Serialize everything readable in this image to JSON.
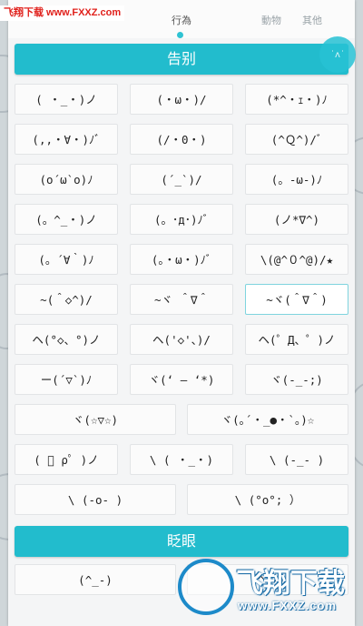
{
  "watermark": {
    "text": "飞翔下载 www.FXXZ.com"
  },
  "tabs": [
    {
      "label": "行為",
      "active": true
    },
    {
      "label": "動物",
      "active": false
    },
    {
      "label": "其他",
      "active": false
    }
  ],
  "fab": {
    "label": "˙ʌ˙"
  },
  "sections": [
    {
      "title": "告别",
      "rows": [
        [
          "( ・_・)ノ",
          "(・ω・)/",
          "(*^・ｪ・)ﾉ"
        ],
        [
          "(,,・∀・)ﾉﾞ",
          "(/・0・)",
          "(^Ｑ^)/ﾞ"
        ],
        [
          "(o´ω`o)ﾉ",
          "(´_`)/",
          "(。-ω-)ﾉ"
        ],
        [
          "(。^_・)ノ",
          "(。･д･)ﾉﾞ",
          "(ノ*∇^)"
        ],
        [
          "(。´∀｀)ﾉ",
          "(。・ω・)ﾉﾞ",
          "\\(@^０^@)/★"
        ],
        [
          "~(＾◇^)/",
          "~ヾ ＾∇＾",
          "~ヾ(＾∇＾)"
        ],
        [
          "ヘ(°◇、°)ノ",
          "ヘ('◇'、)/",
          "ヘ(゜Д、゜)ノ"
        ],
        [
          "ー(´▽`)ﾉ",
          "ヾ(‘ – ‘*)",
          "ヾ(-_-;)"
        ],
        [
          "ヾ(☆▽☆)",
          "ヾ(｡´・_●・`｡)☆"
        ],
        [
          "( ﾟ ρﾟ )ノ",
          "\\ ( ・_・)",
          "\\ (-_- )"
        ],
        [
          "\\ (-o- )",
          "\\ (°o°; ）"
        ]
      ]
    },
    {
      "title": "眨眼",
      "rows": [
        [
          "(^_-)",
          "(^_-)"
        ]
      ]
    }
  ],
  "logo": {
    "text": "飞翔下载",
    "url": "www.FXXZ.com"
  },
  "colors": {
    "accent": "#22bccd",
    "panel": "#f4f5f6",
    "card": "#fbfbfb"
  }
}
